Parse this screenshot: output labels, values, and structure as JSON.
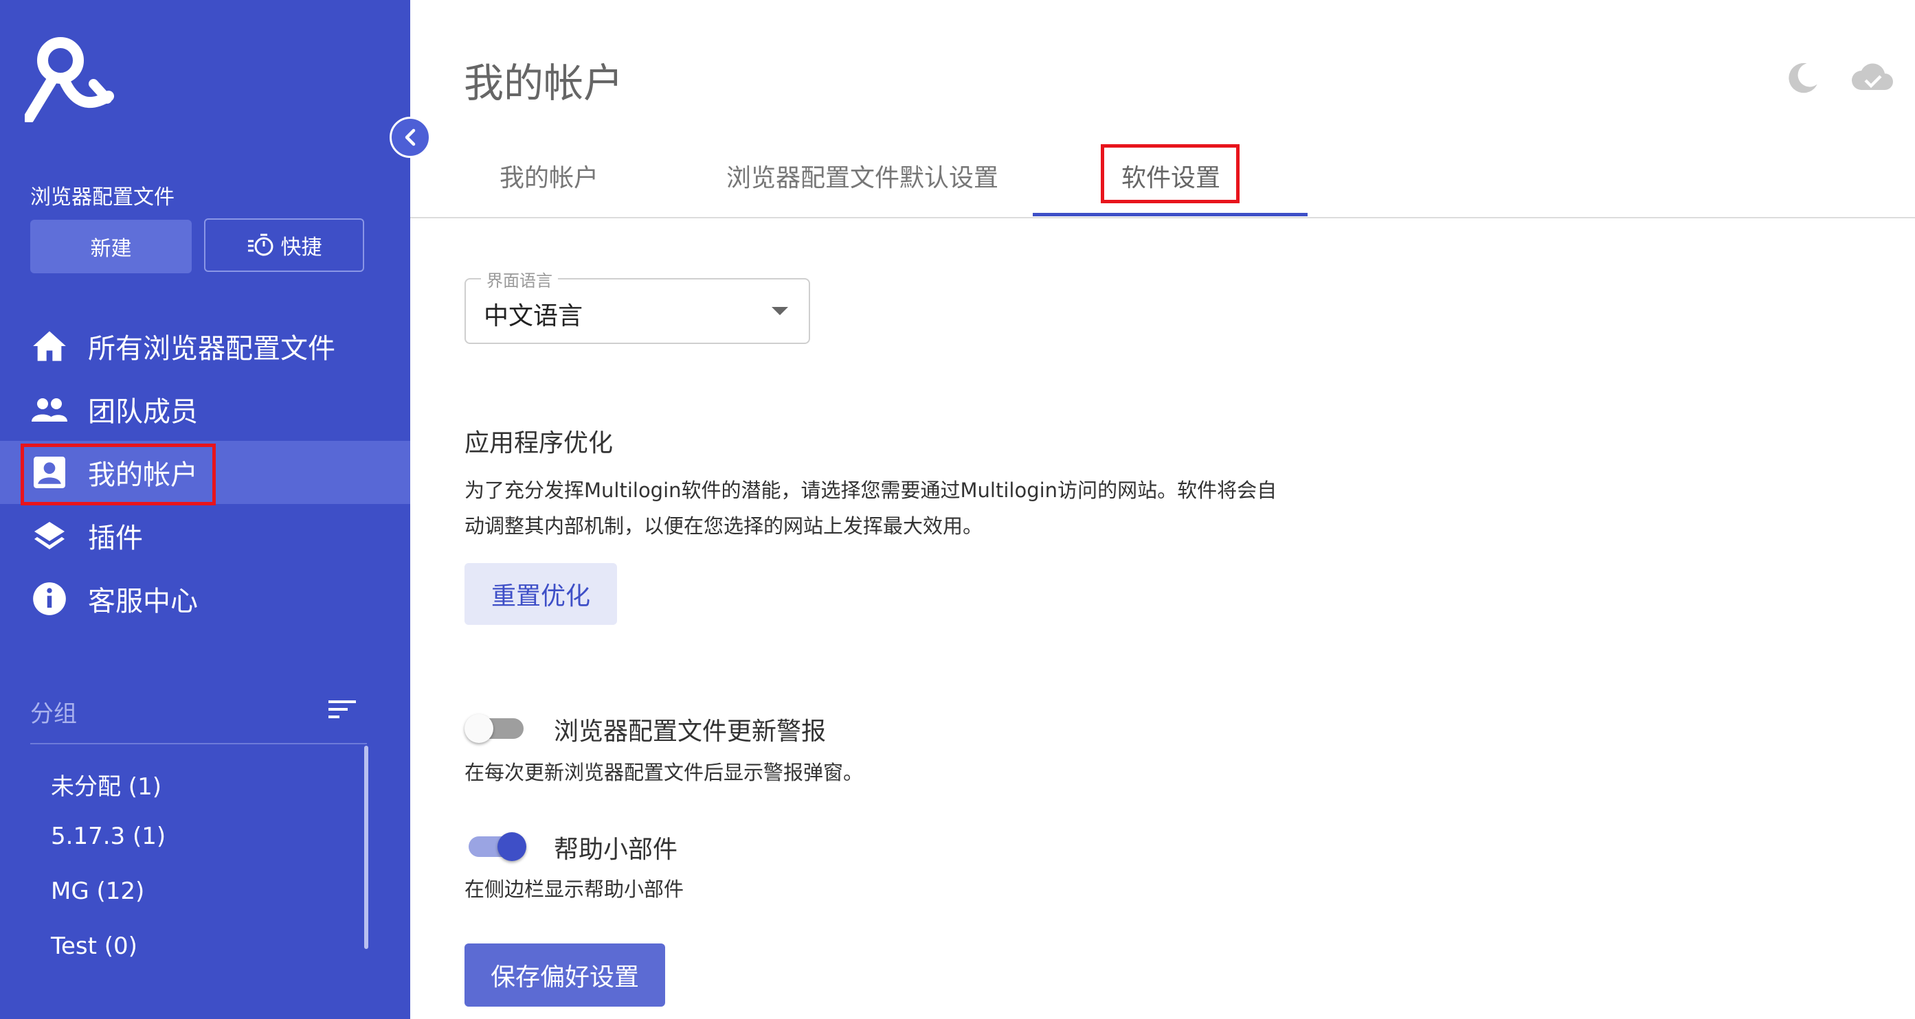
{
  "sidebar": {
    "section_label": "浏览器配置文件",
    "new_button": "新建",
    "quick_button": "快捷",
    "nav": [
      {
        "label": "所有浏览器配置文件",
        "icon": "home-icon"
      },
      {
        "label": "团队成员",
        "icon": "people-icon"
      },
      {
        "label": "我的帐户",
        "icon": "account-box-icon",
        "active": true
      },
      {
        "label": "插件",
        "icon": "layers-icon"
      },
      {
        "label": "客服中心",
        "icon": "info-icon"
      }
    ],
    "groups_label": "分组",
    "groups": [
      {
        "label": "未分配 (1)"
      },
      {
        "label": "5.17.3 (1)"
      },
      {
        "label": "MG (12)"
      },
      {
        "label": "Test (0)"
      }
    ]
  },
  "header": {
    "title": "我的帐户",
    "icons": [
      "moon-icon",
      "cloud-check-icon"
    ]
  },
  "tabs": [
    {
      "label": "我的帐户"
    },
    {
      "label": "浏览器配置文件默认设置"
    },
    {
      "label": "软件设置",
      "active": true
    }
  ],
  "language": {
    "label": "界面语言",
    "value": "中文语言"
  },
  "optimization": {
    "title": "应用程序优化",
    "description_line1": "为了充分发挥Multilogin软件的潜能，请选择您需要通过Multilogin访问的网站。软件将会自",
    "description_line2": "动调整其内部机制，以便在您选择的网站上发挥最大效用。",
    "reset_button": "重置优化"
  },
  "settings": [
    {
      "title": "浏览器配置文件更新警报",
      "description": "在每次更新浏览器配置文件后显示警报弹窗。",
      "enabled": false
    },
    {
      "title": "帮助小部件",
      "description": "在侧边栏显示帮助小部件",
      "enabled": true
    }
  ],
  "save_button": "保存偏好设置",
  "colors": {
    "sidebar": "#3e4fc7",
    "accent": "#3e4fc7",
    "highlight": "#e8141c"
  }
}
